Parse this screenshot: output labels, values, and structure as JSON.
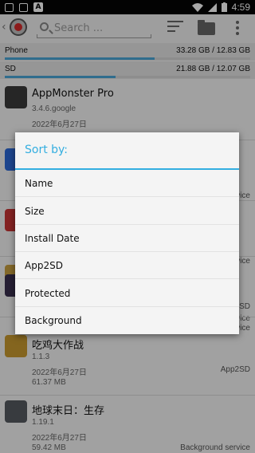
{
  "status_bar": {
    "time": "4:59",
    "left_icons": [
      "notification-icon",
      "app-icon",
      "a-icon"
    ],
    "right_icons": [
      "wifi-icon",
      "signal-icon",
      "battery-icon"
    ]
  },
  "action_bar": {
    "search_placeholder": "Search ...",
    "icons": [
      "chevron-left-icon",
      "app-logo",
      "search-icon",
      "sort-icon",
      "folder-icon",
      "more-icon"
    ]
  },
  "storage": [
    {
      "label": "Phone",
      "value": "33.28 GB / 12.83 GB",
      "fill_fraction": 0.61
    },
    {
      "label": "SD",
      "value": "21.88 GB / 12.07 GB",
      "fill_fraction": 0.45
    }
  ],
  "apps": [
    {
      "name": "AppMonster Pro",
      "version": "3.4.6.google",
      "date": "2022年6月27日",
      "size": "",
      "tag": "",
      "icon_color": "#3a3a3a"
    },
    {
      "name": "",
      "version": "",
      "date": "",
      "size": "",
      "tag": "service",
      "icon_color": "#2c6ad8"
    },
    {
      "name": "",
      "version": "",
      "date": "",
      "size": "",
      "tag": "service",
      "icon_color": "#c83434"
    },
    {
      "name": "",
      "version": "",
      "date": "",
      "size": "",
      "tag": "rvice",
      "icon_color": "#c8a040"
    },
    {
      "name": "",
      "version": "",
      "date": "",
      "size": "",
      "tag": "2SD",
      "icon_color": "#3a3050"
    },
    {
      "name": "",
      "version": "",
      "date": "",
      "size": "",
      "tag": "rvice",
      "icon_color": "#555"
    },
    {
      "name": "吃鸡大作战",
      "version": "1.1.3",
      "date": "2022年6月27日",
      "size": "61.37 MB",
      "tag": "App2SD",
      "icon_color": "#c89a30"
    },
    {
      "name": "地球末日：生存",
      "version": "1.19.1",
      "date": "2022年6月27日",
      "size": "59.42 MB",
      "tag": "Background service",
      "icon_color": "#555a60"
    }
  ],
  "dialog": {
    "title": "Sort by:",
    "options": [
      "Name",
      "Size",
      "Install Date",
      "App2SD",
      "Protected",
      "Background"
    ]
  }
}
